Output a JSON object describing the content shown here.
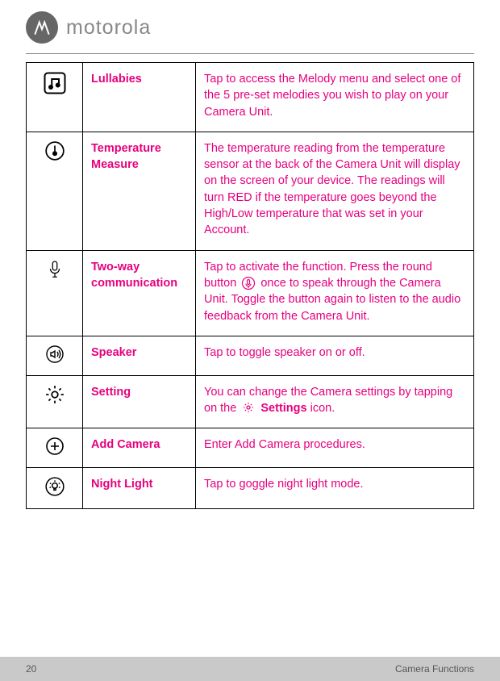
{
  "brand": {
    "wordmark": "motorola"
  },
  "rows": [
    {
      "icon": "music-icon",
      "label": "Lullabies",
      "desc": "Tap to access the Melody menu and select one of the 5 pre-set melodies you wish to play on your Camera Unit."
    },
    {
      "icon": "thermometer-icon",
      "label": "Temperature Measure",
      "desc": "The temperature reading from the temperature sensor at the back of the Camera Unit will display on the screen of your device. The readings will turn RED if the temperature goes beyond the High/Low temperature that was set in your Account."
    },
    {
      "icon": "microphone-icon",
      "label": "Two-way communication",
      "desc_pre": "Tap to activate the function. Press the round button ",
      "desc_post": " once to speak through the Camera Unit. Toggle the button again to listen to the audio feedback from the Camera Unit."
    },
    {
      "icon": "speaker-icon",
      "label": "Speaker",
      "desc": "Tap to toggle speaker on or off."
    },
    {
      "icon": "gear-icon",
      "label": "Setting",
      "desc_pre": "You can change the Camera settings by tapping  on the ",
      "desc_bold": "Settings",
      "desc_post": " icon."
    },
    {
      "icon": "plus-icon",
      "label": "Add Camera",
      "desc": "Enter Add Camera procedures."
    },
    {
      "icon": "bulb-icon",
      "label": "Night Light",
      "desc": "Tap to goggle night light mode."
    }
  ],
  "footer": {
    "page": "20",
    "section": "Camera Functions"
  }
}
